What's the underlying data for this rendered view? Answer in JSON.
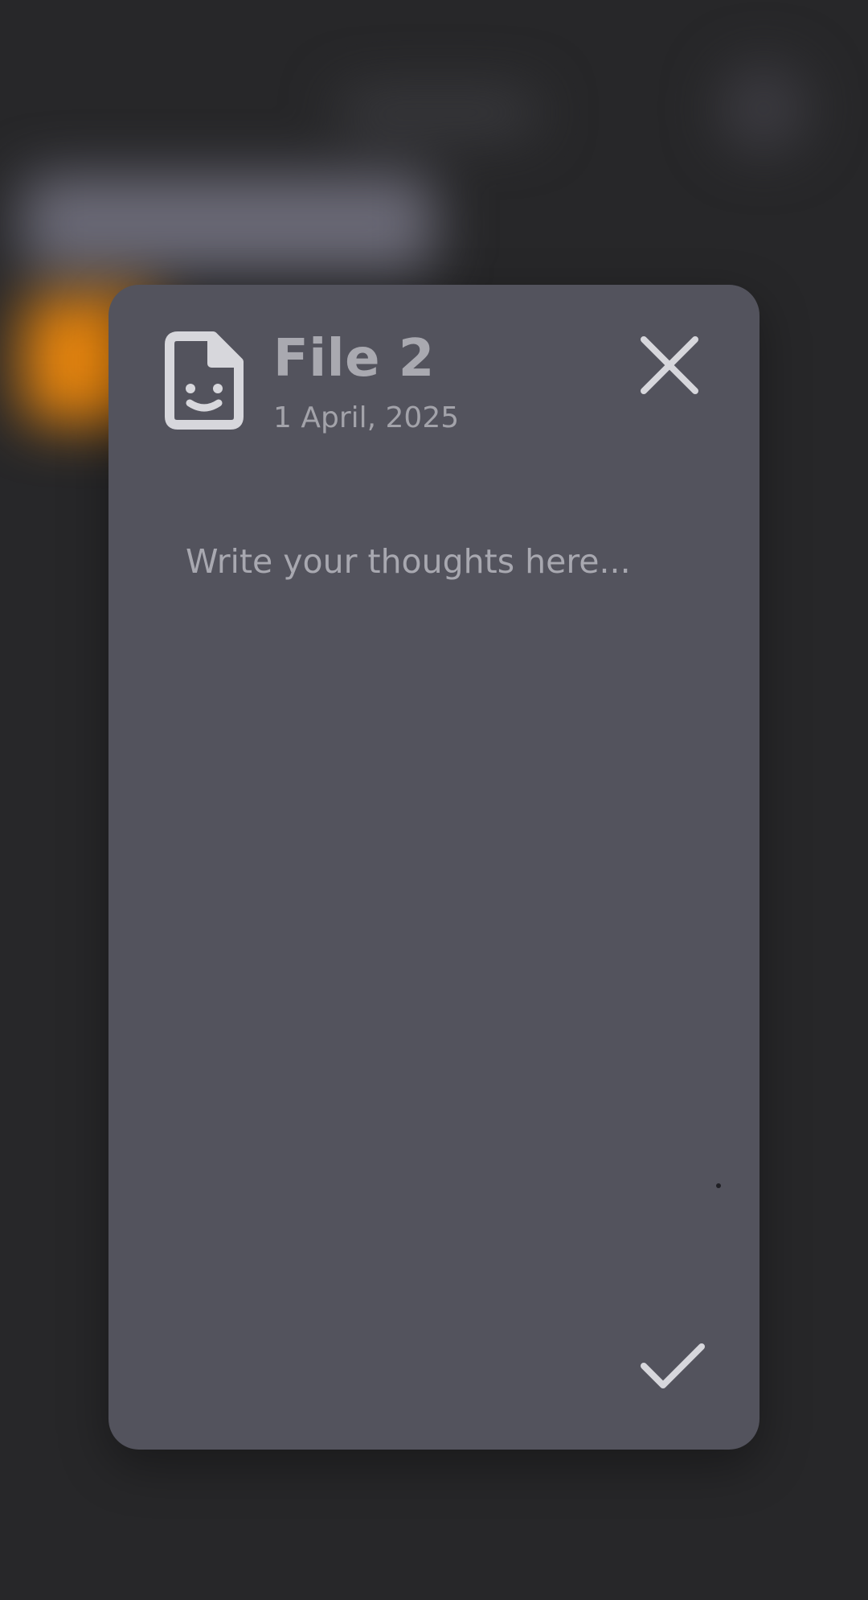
{
  "note": {
    "title": "File 2",
    "date": "1 April, 2025",
    "placeholder": "Write your thoughts here...",
    "content": ""
  },
  "icons": {
    "file": "file-smile-icon",
    "close": "close-icon",
    "confirm": "check-icon"
  },
  "colors": {
    "background": "#272729",
    "dialog": "#53535d",
    "accent": "#e6850f",
    "icon": "#d7d7dc",
    "text": "#a9a9b0"
  }
}
